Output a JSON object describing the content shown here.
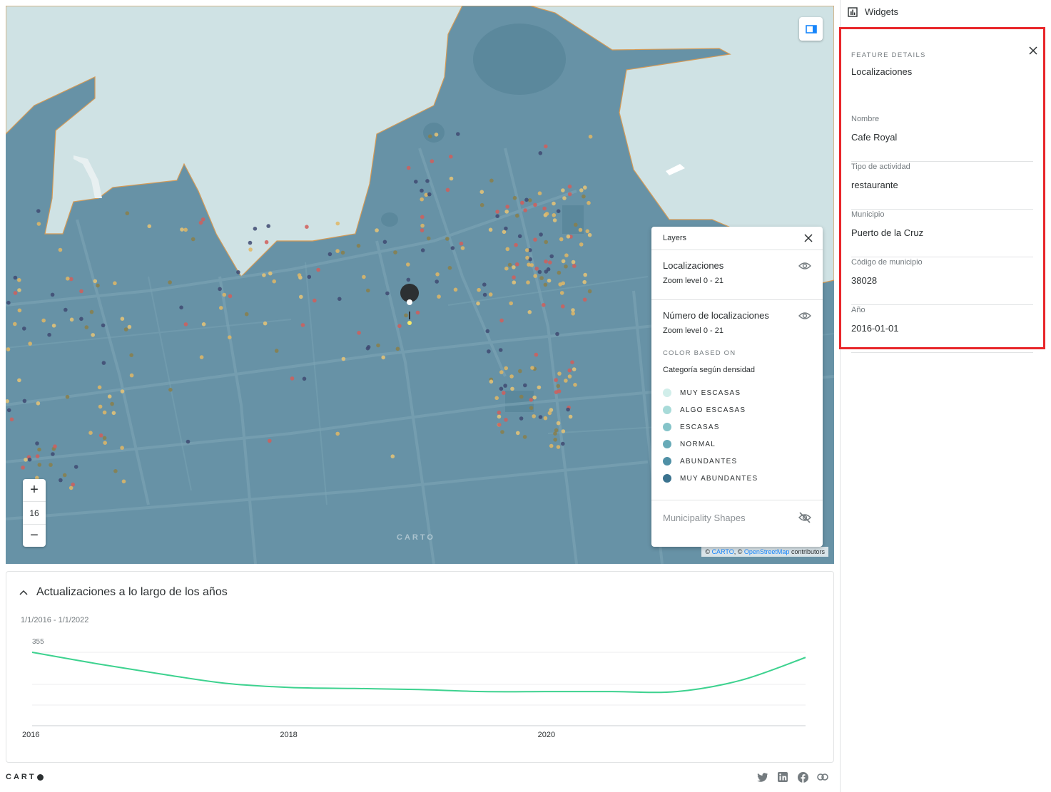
{
  "map": {
    "zoom_in_label": "+",
    "zoom_level": "16",
    "zoom_out_label": "−",
    "watermark": "CARTO",
    "attribution": {
      "copy1": "©",
      "carto_link": "CARTO",
      "sep": ", ©",
      "osm_link": "OpenStreetMap",
      "suffix": "contributors"
    },
    "colors": {
      "land": "#6792a6",
      "sea": "#cfe2e4",
      "coast": "#d59a55"
    }
  },
  "layers_panel": {
    "title": "Layers",
    "layers": [
      {
        "name": "Localizaciones",
        "zoom": "Zoom level 0 - 21"
      },
      {
        "name": "Número de localizaciones",
        "zoom": "Zoom level 0 - 21"
      }
    ],
    "color_based_on_label": "COLOR BASED ON",
    "color_category": "Categoría según densidad",
    "legend": [
      {
        "label": "MUY ESCASAS",
        "color": "#d1eeea"
      },
      {
        "label": "ALGO ESCASAS",
        "color": "#a8dbd9"
      },
      {
        "label": "ESCASAS",
        "color": "#85c4c9"
      },
      {
        "label": "NORMAL",
        "color": "#68abb8"
      },
      {
        "label": "ABUNDANTES",
        "color": "#4f90a6"
      },
      {
        "label": "MUY ABUNDANTES",
        "color": "#3b738f"
      }
    ],
    "municipality": "Municipality Shapes"
  },
  "chart": {
    "title": "Actualizaciones a lo largo de los años",
    "range": "1/1/2016 - 1/1/2022",
    "max_label": "355"
  },
  "chart_data": {
    "type": "line",
    "title": "Actualizaciones a lo largo de los años",
    "x_tick_labels": [
      "2016",
      "2018",
      "2020"
    ],
    "x": [
      2016.0,
      2016.5,
      2017.0,
      2017.5,
      2018.0,
      2018.5,
      2019.0,
      2019.5,
      2020.0,
      2020.5,
      2021.0,
      2021.5,
      2022.0
    ],
    "series": [
      {
        "values": [
          355,
          300,
          250,
          205,
          185,
          180,
          175,
          165,
          165,
          165,
          165,
          220,
          330
        ]
      }
    ],
    "ylim": [
      0,
      355
    ],
    "grid": true,
    "color": "#3dd28f"
  },
  "footer": {
    "logo": "CART"
  },
  "sidebar": {
    "title": "Widgets",
    "feature": {
      "overline": "FEATURE DETAILS",
      "layer": "Localizaciones",
      "fields": [
        {
          "label": "Nombre",
          "value": "Cafe Royal"
        },
        {
          "label": "Tipo de actividad",
          "value": "restaurante"
        },
        {
          "label": "Municipio",
          "value": "Puerto de la Cruz"
        },
        {
          "label": "Código de municipio",
          "value": "38028"
        },
        {
          "label": "Año",
          "value": "2016-01-01"
        }
      ]
    }
  }
}
